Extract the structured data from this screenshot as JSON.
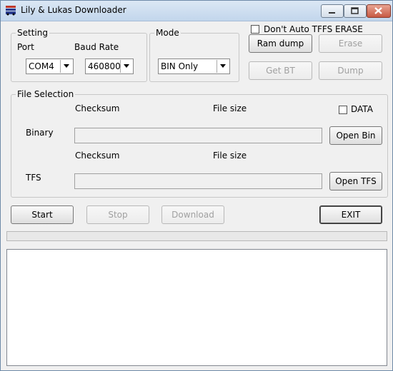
{
  "window": {
    "title": "Lily & Lukas Downloader"
  },
  "setting": {
    "group_title": "Setting",
    "port_label": "Port",
    "baud_label": "Baud Rate",
    "port_value": "COM4",
    "baud_value": "460800"
  },
  "mode": {
    "group_title": "Mode",
    "value": "BIN Only"
  },
  "options": {
    "no_tffs_erase_label": "Don't Auto TFFS ERASE",
    "no_tffs_erase_checked": false
  },
  "actions": {
    "ram_dump": "Ram dump",
    "erase": "Erase",
    "get_bt": "Get BT",
    "dump": "Dump"
  },
  "file_selection": {
    "group_title": "File Selection",
    "checksum_label_1": "Checksum",
    "file_size_label_1": "File size",
    "data_label": "DATA",
    "data_checked": false,
    "binary_label": "Binary",
    "binary_value": "",
    "open_bin": "Open Bin",
    "checksum_label_2": "Checksum",
    "file_size_label_2": "File size",
    "tfs_label": "TFS",
    "tfs_value": "",
    "open_tfs": "Open TFS"
  },
  "bottom": {
    "start": "Start",
    "stop": "Stop",
    "download": "Download",
    "exit": "EXIT"
  },
  "progress": {
    "value": 0
  },
  "log": {
    "text": ""
  }
}
